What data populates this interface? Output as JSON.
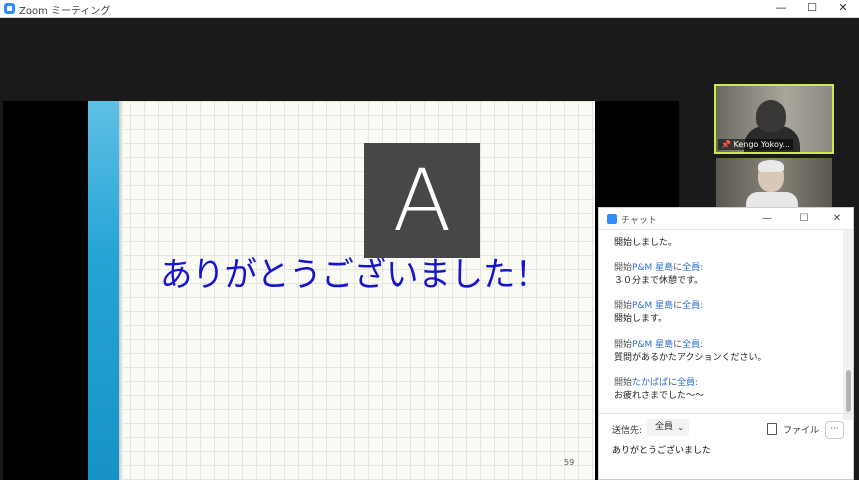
{
  "window": {
    "title": "Zoom ミーティング",
    "min_glyph": "—",
    "max_glyph": "☐",
    "close_glyph": "✕"
  },
  "slide": {
    "text": "ありがとうございました！",
    "page_number": "59"
  },
  "speaker_avatar": {
    "initial": "A"
  },
  "participants": [
    {
      "label": "Kengo Yokoy..."
    }
  ],
  "chat": {
    "title": "チャット",
    "min_glyph": "—",
    "max_glyph": "☐",
    "close_glyph": "✕",
    "messages": [
      {
        "prefix": "",
        "from": "",
        "to": "",
        "text": "開始しました。"
      },
      {
        "prefix": "開始",
        "from": "P&M 星島",
        "to": "全員:",
        "text": "３０分まで休憩です。"
      },
      {
        "prefix": "開始",
        "from": "P&M 星島",
        "to": "全員:",
        "text": "開始します。"
      },
      {
        "prefix": "開始",
        "from": "P&M 星島",
        "to": "全員:",
        "text": "質問があるかたアクションください。"
      },
      {
        "prefix": "開始",
        "from": "たかぱぱ",
        "to": "全員:",
        "text": "お疲れさまでした〜〜"
      }
    ],
    "send_to_label": "送信先:",
    "send_to_value": "全員",
    "file_label": "ファイル",
    "more_label": "···",
    "input_value": "ありがとうございました"
  },
  "colors": {
    "accent": "#2d8cff",
    "active_speaker_border": "#cfe84a",
    "slide_title": "#1515cc",
    "sender_name": "#2a6fd1"
  }
}
